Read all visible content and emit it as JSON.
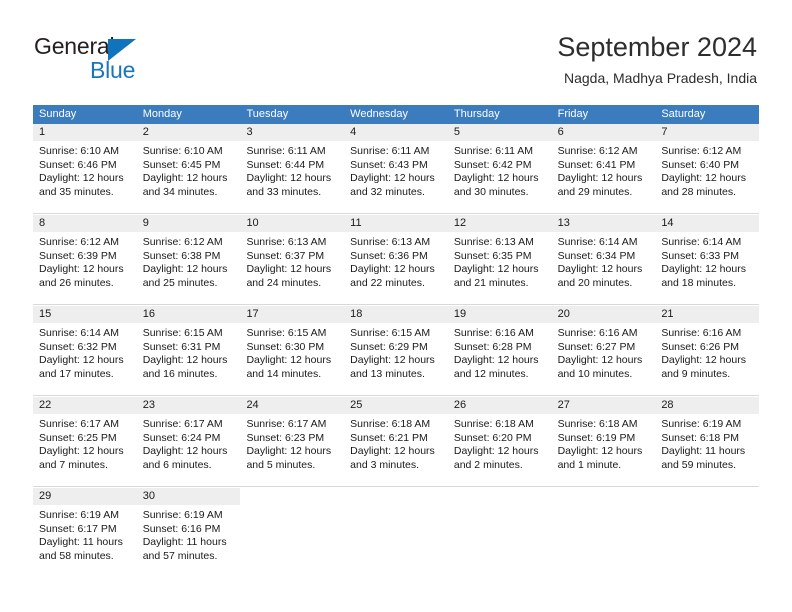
{
  "brand": {
    "name_part1": "General",
    "name_part2": "Blue",
    "accent_color": "#1b75bb",
    "header_color": "#3a7cbe"
  },
  "header": {
    "month_title": "September 2024",
    "location": "Nagda, Madhya Pradesh, India"
  },
  "weekdays": [
    "Sunday",
    "Monday",
    "Tuesday",
    "Wednesday",
    "Thursday",
    "Friday",
    "Saturday"
  ],
  "weeks": [
    [
      {
        "day": "1",
        "sunrise": "Sunrise: 6:10 AM",
        "sunset": "Sunset: 6:46 PM",
        "daylight1": "Daylight: 12 hours",
        "daylight2": "and 35 minutes."
      },
      {
        "day": "2",
        "sunrise": "Sunrise: 6:10 AM",
        "sunset": "Sunset: 6:45 PM",
        "daylight1": "Daylight: 12 hours",
        "daylight2": "and 34 minutes."
      },
      {
        "day": "3",
        "sunrise": "Sunrise: 6:11 AM",
        "sunset": "Sunset: 6:44 PM",
        "daylight1": "Daylight: 12 hours",
        "daylight2": "and 33 minutes."
      },
      {
        "day": "4",
        "sunrise": "Sunrise: 6:11 AM",
        "sunset": "Sunset: 6:43 PM",
        "daylight1": "Daylight: 12 hours",
        "daylight2": "and 32 minutes."
      },
      {
        "day": "5",
        "sunrise": "Sunrise: 6:11 AM",
        "sunset": "Sunset: 6:42 PM",
        "daylight1": "Daylight: 12 hours",
        "daylight2": "and 30 minutes."
      },
      {
        "day": "6",
        "sunrise": "Sunrise: 6:12 AM",
        "sunset": "Sunset: 6:41 PM",
        "daylight1": "Daylight: 12 hours",
        "daylight2": "and 29 minutes."
      },
      {
        "day": "7",
        "sunrise": "Sunrise: 6:12 AM",
        "sunset": "Sunset: 6:40 PM",
        "daylight1": "Daylight: 12 hours",
        "daylight2": "and 28 minutes."
      }
    ],
    [
      {
        "day": "8",
        "sunrise": "Sunrise: 6:12 AM",
        "sunset": "Sunset: 6:39 PM",
        "daylight1": "Daylight: 12 hours",
        "daylight2": "and 26 minutes."
      },
      {
        "day": "9",
        "sunrise": "Sunrise: 6:12 AM",
        "sunset": "Sunset: 6:38 PM",
        "daylight1": "Daylight: 12 hours",
        "daylight2": "and 25 minutes."
      },
      {
        "day": "10",
        "sunrise": "Sunrise: 6:13 AM",
        "sunset": "Sunset: 6:37 PM",
        "daylight1": "Daylight: 12 hours",
        "daylight2": "and 24 minutes."
      },
      {
        "day": "11",
        "sunrise": "Sunrise: 6:13 AM",
        "sunset": "Sunset: 6:36 PM",
        "daylight1": "Daylight: 12 hours",
        "daylight2": "and 22 minutes."
      },
      {
        "day": "12",
        "sunrise": "Sunrise: 6:13 AM",
        "sunset": "Sunset: 6:35 PM",
        "daylight1": "Daylight: 12 hours",
        "daylight2": "and 21 minutes."
      },
      {
        "day": "13",
        "sunrise": "Sunrise: 6:14 AM",
        "sunset": "Sunset: 6:34 PM",
        "daylight1": "Daylight: 12 hours",
        "daylight2": "and 20 minutes."
      },
      {
        "day": "14",
        "sunrise": "Sunrise: 6:14 AM",
        "sunset": "Sunset: 6:33 PM",
        "daylight1": "Daylight: 12 hours",
        "daylight2": "and 18 minutes."
      }
    ],
    [
      {
        "day": "15",
        "sunrise": "Sunrise: 6:14 AM",
        "sunset": "Sunset: 6:32 PM",
        "daylight1": "Daylight: 12 hours",
        "daylight2": "and 17 minutes."
      },
      {
        "day": "16",
        "sunrise": "Sunrise: 6:15 AM",
        "sunset": "Sunset: 6:31 PM",
        "daylight1": "Daylight: 12 hours",
        "daylight2": "and 16 minutes."
      },
      {
        "day": "17",
        "sunrise": "Sunrise: 6:15 AM",
        "sunset": "Sunset: 6:30 PM",
        "daylight1": "Daylight: 12 hours",
        "daylight2": "and 14 minutes."
      },
      {
        "day": "18",
        "sunrise": "Sunrise: 6:15 AM",
        "sunset": "Sunset: 6:29 PM",
        "daylight1": "Daylight: 12 hours",
        "daylight2": "and 13 minutes."
      },
      {
        "day": "19",
        "sunrise": "Sunrise: 6:16 AM",
        "sunset": "Sunset: 6:28 PM",
        "daylight1": "Daylight: 12 hours",
        "daylight2": "and 12 minutes."
      },
      {
        "day": "20",
        "sunrise": "Sunrise: 6:16 AM",
        "sunset": "Sunset: 6:27 PM",
        "daylight1": "Daylight: 12 hours",
        "daylight2": "and 10 minutes."
      },
      {
        "day": "21",
        "sunrise": "Sunrise: 6:16 AM",
        "sunset": "Sunset: 6:26 PM",
        "daylight1": "Daylight: 12 hours",
        "daylight2": "and 9 minutes."
      }
    ],
    [
      {
        "day": "22",
        "sunrise": "Sunrise: 6:17 AM",
        "sunset": "Sunset: 6:25 PM",
        "daylight1": "Daylight: 12 hours",
        "daylight2": "and 7 minutes."
      },
      {
        "day": "23",
        "sunrise": "Sunrise: 6:17 AM",
        "sunset": "Sunset: 6:24 PM",
        "daylight1": "Daylight: 12 hours",
        "daylight2": "and 6 minutes."
      },
      {
        "day": "24",
        "sunrise": "Sunrise: 6:17 AM",
        "sunset": "Sunset: 6:23 PM",
        "daylight1": "Daylight: 12 hours",
        "daylight2": "and 5 minutes."
      },
      {
        "day": "25",
        "sunrise": "Sunrise: 6:18 AM",
        "sunset": "Sunset: 6:21 PM",
        "daylight1": "Daylight: 12 hours",
        "daylight2": "and 3 minutes."
      },
      {
        "day": "26",
        "sunrise": "Sunrise: 6:18 AM",
        "sunset": "Sunset: 6:20 PM",
        "daylight1": "Daylight: 12 hours",
        "daylight2": "and 2 minutes."
      },
      {
        "day": "27",
        "sunrise": "Sunrise: 6:18 AM",
        "sunset": "Sunset: 6:19 PM",
        "daylight1": "Daylight: 12 hours",
        "daylight2": "and 1 minute."
      },
      {
        "day": "28",
        "sunrise": "Sunrise: 6:19 AM",
        "sunset": "Sunset: 6:18 PM",
        "daylight1": "Daylight: 11 hours",
        "daylight2": "and 59 minutes."
      }
    ],
    [
      {
        "day": "29",
        "sunrise": "Sunrise: 6:19 AM",
        "sunset": "Sunset: 6:17 PM",
        "daylight1": "Daylight: 11 hours",
        "daylight2": "and 58 minutes."
      },
      {
        "day": "30",
        "sunrise": "Sunrise: 6:19 AM",
        "sunset": "Sunset: 6:16 PM",
        "daylight1": "Daylight: 11 hours",
        "daylight2": "and 57 minutes."
      },
      {
        "day": "",
        "sunrise": "",
        "sunset": "",
        "daylight1": "",
        "daylight2": ""
      },
      {
        "day": "",
        "sunrise": "",
        "sunset": "",
        "daylight1": "",
        "daylight2": ""
      },
      {
        "day": "",
        "sunrise": "",
        "sunset": "",
        "daylight1": "",
        "daylight2": ""
      },
      {
        "day": "",
        "sunrise": "",
        "sunset": "",
        "daylight1": "",
        "daylight2": ""
      },
      {
        "day": "",
        "sunrise": "",
        "sunset": "",
        "daylight1": "",
        "daylight2": ""
      }
    ]
  ]
}
